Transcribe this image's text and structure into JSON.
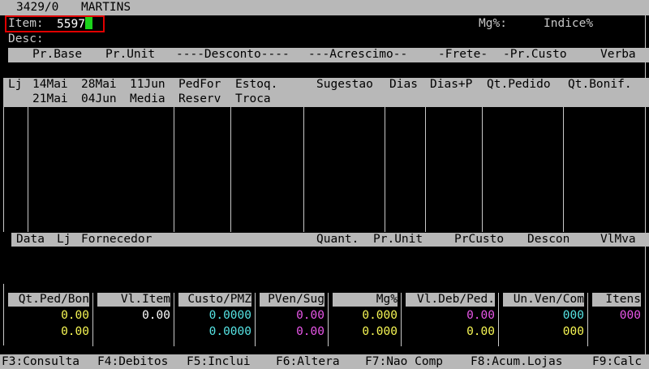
{
  "title_bar": {
    "code": "3429/0",
    "name": "MARTINS"
  },
  "item": {
    "label": "Item:",
    "value": "5597"
  },
  "mg_label": "Mg%:",
  "indice_label": "Indice%",
  "desc_label": "Desc:",
  "price_header": [
    "Pr.Base",
    "Pr.Unit",
    "----Desconto----",
    "---Acrescimo--",
    "-Frete-",
    "-Pr.Custo",
    "Verba"
  ],
  "grid_header_row1": [
    "Lj",
    "14Mai",
    "28Mai",
    "11Jun",
    "PedFor",
    "Estoq.",
    "Sugestao",
    "Dias",
    "Dias+P",
    "Qt.Pedido",
    "Qt.Bonif."
  ],
  "grid_header_row2": [
    "21Mai",
    "04Jun",
    "Media",
    "Reserv",
    "Troca"
  ],
  "history_header": [
    "Data",
    "Lj",
    "Fornecedor",
    "Quant.",
    "Pr.Unit",
    "PrCusto",
    "Descon",
    "VlMva"
  ],
  "summary": {
    "headers": [
      "Qt.Ped/Bon",
      "Vl.Item",
      "Custo/PMZ",
      "PVen/Sug",
      "Mg%",
      "Vl.Deb/Ped.",
      "Un.Ven/Com",
      "Itens"
    ],
    "row1": [
      "0.00",
      "0.00",
      "0.0000",
      "0.00",
      "0.000",
      "0.00",
      "000",
      "000"
    ],
    "row2": [
      "0.00",
      "",
      "0.0000",
      "0.00",
      "0.000",
      "0.00",
      "000",
      ""
    ]
  },
  "function_keys": [
    "F3:Consulta",
    "F4:Debitos",
    "F5:Inclui",
    "F6:Altera",
    "F7:Nao Comp",
    "F8:Acum.Lojas",
    "F9:Calc"
  ],
  "colors": {
    "bar_gray": "#b8b8b8",
    "yellow": "#f5f554",
    "cyan": "#56e3e3",
    "magenta": "#e856e8",
    "cursor_green": "#1bd31b",
    "highlight_red": "#e00000"
  }
}
